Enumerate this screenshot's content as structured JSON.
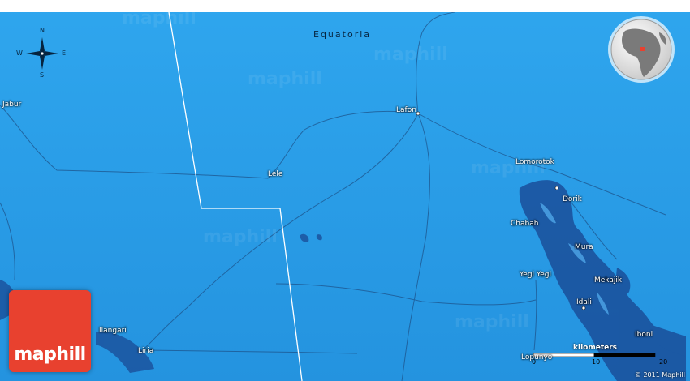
{
  "map": {
    "region_label": "Equatoria",
    "background_color": "#2a9be6",
    "border_color": "#ffffff",
    "places": [
      {
        "id": "jabur",
        "name": "Jabur"
      },
      {
        "id": "lafon",
        "name": "Lafon"
      },
      {
        "id": "lele",
        "name": "Lele"
      },
      {
        "id": "lomorotok",
        "name": "Lomorotok"
      },
      {
        "id": "dorik",
        "name": "Dorik"
      },
      {
        "id": "chabah",
        "name": "Chabah"
      },
      {
        "id": "mura",
        "name": "Mura"
      },
      {
        "id": "yegi-yegi",
        "name": "Yegi Yegi"
      },
      {
        "id": "mekajik",
        "name": "Mekajik"
      },
      {
        "id": "idali",
        "name": "Idali"
      },
      {
        "id": "ilangari",
        "name": "Ilangari"
      },
      {
        "id": "liria",
        "name": "Liria"
      },
      {
        "id": "iboni",
        "name": "Iboni"
      },
      {
        "id": "lopunyo",
        "name": "Lopunyo"
      }
    ]
  },
  "compass": {
    "north": "N",
    "south": "S",
    "east": "E",
    "west": "W"
  },
  "logo": {
    "text": "maphill",
    "color": "#e8412f"
  },
  "watermark": "maphill",
  "scale": {
    "title": "kilometers",
    "ticks": [
      "0",
      "10",
      "20"
    ]
  },
  "copyright": "© 2011 Maphill",
  "locator": {
    "icon": "globe-locator-icon",
    "marker_color": "#e8412f"
  }
}
